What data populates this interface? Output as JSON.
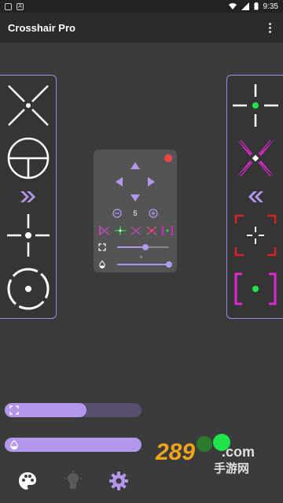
{
  "status_bar": {
    "time": "9:35"
  },
  "app_bar": {
    "title": "Crosshair Pro"
  },
  "control_panel": {
    "size_value": "5",
    "size_progress": 0.55,
    "opacity_progress": 1.0
  },
  "left_panel": {
    "items": [
      "x-crosshair",
      "scope-crosshair",
      "chevron-right-double",
      "dot-cross",
      "circle-ring"
    ]
  },
  "right_panel": {
    "items": [
      "green-dot-cross",
      "magenta-x",
      "chevron-left-double",
      "red-corner-cross",
      "magenta-bracket-dot"
    ]
  },
  "bottom_controls": {
    "size_fill": 0.6,
    "opacity_fill": 1.0
  },
  "watermark": {
    "text_number": "289",
    "text_suffix": ".com",
    "text_cn": "手游网"
  },
  "colors": {
    "accent": "#b397ee",
    "panel_border": "#a78be0",
    "record": "#f24545",
    "green": "#1ee34a",
    "magenta": "#e025d3",
    "red": "#d62424"
  }
}
